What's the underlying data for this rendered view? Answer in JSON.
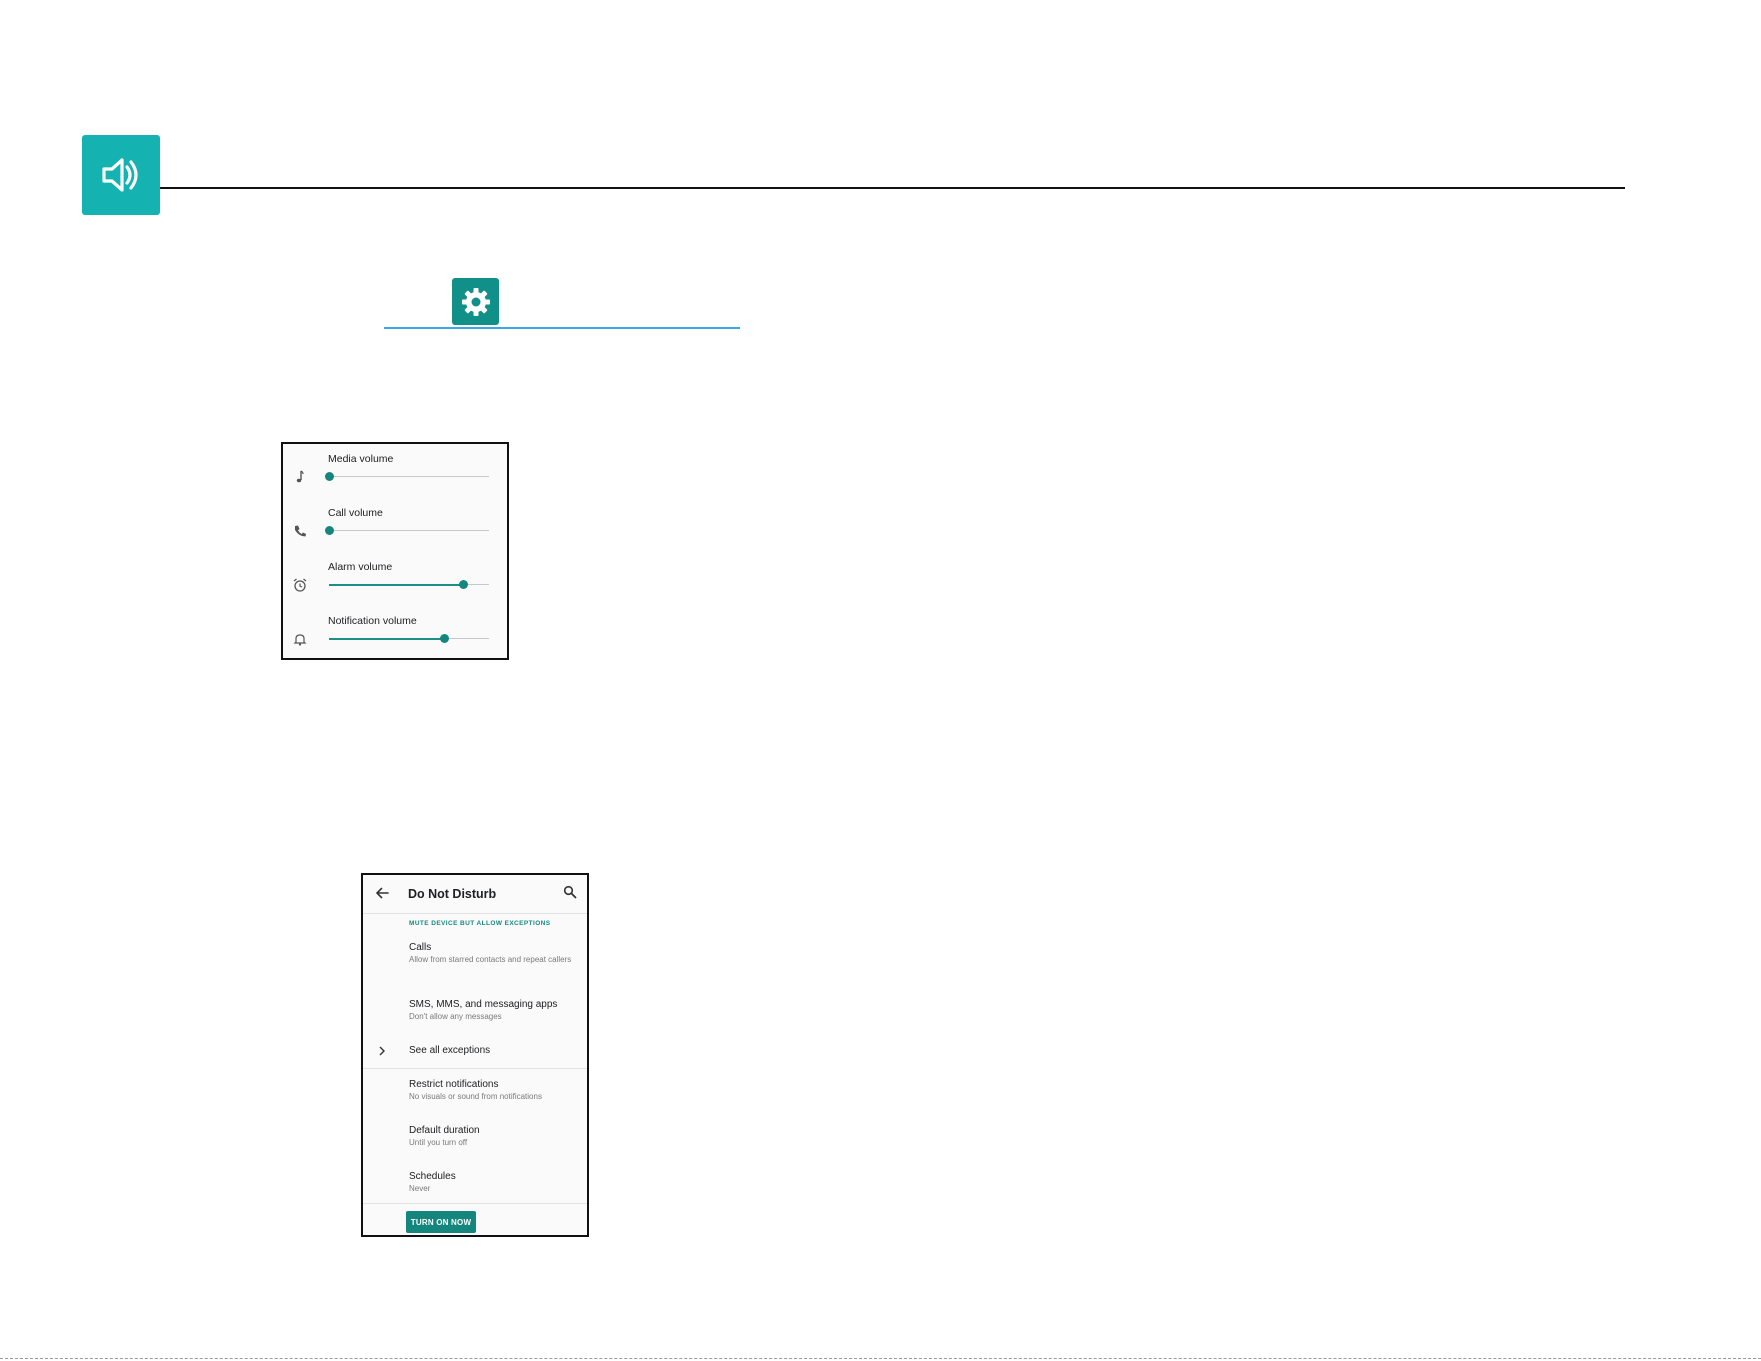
{
  "icons": {
    "header": "speaker-icon",
    "settings": "gear-icon"
  },
  "colors": {
    "header_badge": "#14b3b1",
    "settings_badge": "#119089",
    "accent": "#15867d",
    "blue_rule": "#3aa7e6"
  },
  "volume": {
    "items": [
      {
        "label": "Media volume",
        "icon": "music-note-icon",
        "level": 0.0
      },
      {
        "label": "Call volume",
        "icon": "phone-icon",
        "level": 0.0
      },
      {
        "label": "Alarm volume",
        "icon": "alarm-clock-icon",
        "level": 0.84
      },
      {
        "label": "Notification volume",
        "icon": "bell-icon",
        "level": 0.72
      }
    ]
  },
  "dnd": {
    "title": "Do Not Disturb",
    "section_header": "MUTE DEVICE BUT ALLOW EXCEPTIONS",
    "calls": {
      "title": "Calls",
      "subtitle": "Allow from starred contacts and repeat callers"
    },
    "sms": {
      "title": "SMS, MMS, and messaging apps",
      "subtitle": "Don't allow any messages"
    },
    "exceptions": {
      "title": "See all exceptions"
    },
    "restrict": {
      "title": "Restrict notifications",
      "subtitle": "No visuals or sound from notifications"
    },
    "duration": {
      "title": "Default duration",
      "subtitle": "Until you turn off"
    },
    "schedules": {
      "title": "Schedules",
      "subtitle": "Never"
    },
    "button_label": "TURN ON NOW"
  }
}
